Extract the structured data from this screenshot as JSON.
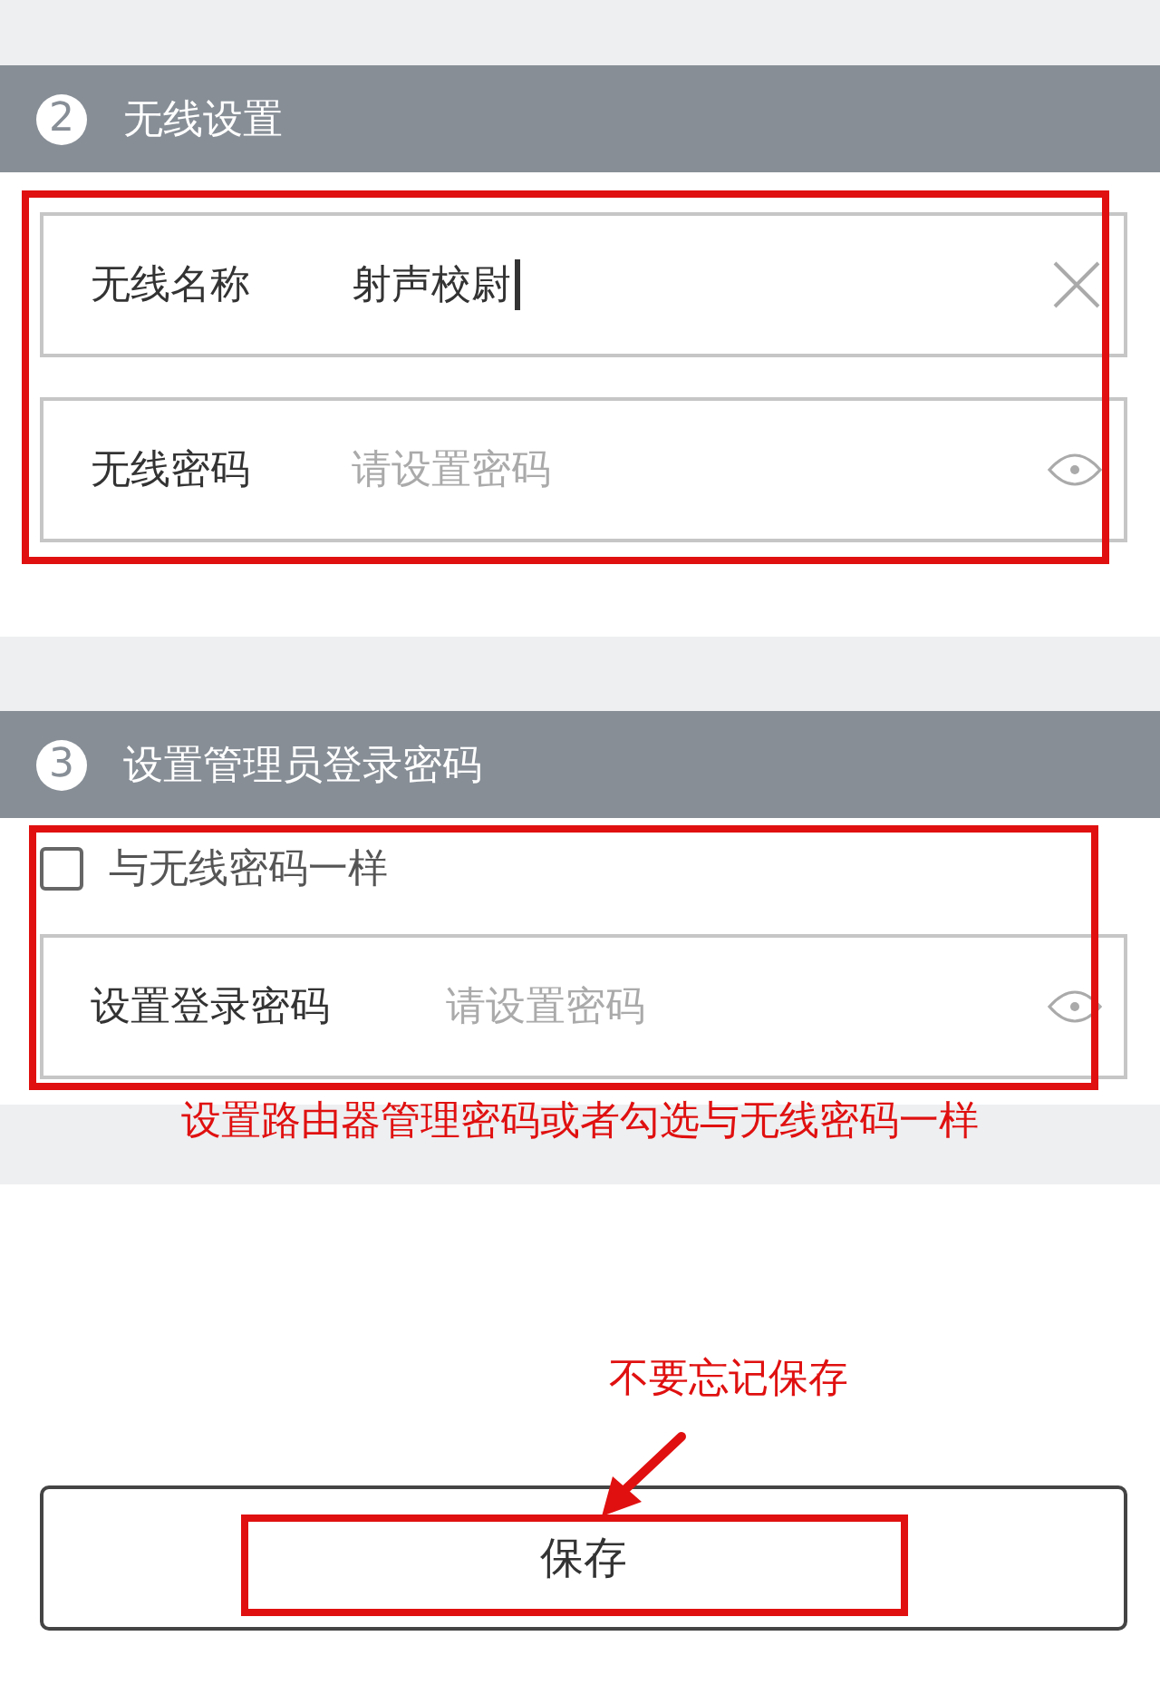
{
  "sections": [
    {
      "number": "2",
      "title": "无线设置",
      "fields": [
        {
          "kind": "text",
          "label": "无线名称",
          "value": "射声校尉"
        },
        {
          "kind": "password",
          "label": "无线密码",
          "placeholder": "请设置密码"
        }
      ]
    },
    {
      "number": "3",
      "title": "设置管理员登录密码",
      "checkbox": {
        "label": "与无线密码一样",
        "checked": false
      },
      "fields": [
        {
          "kind": "password",
          "label": "设置登录密码",
          "placeholder": "请设置密码"
        }
      ],
      "note": "设置路由器管理密码或者勾选与无线密码一样"
    }
  ],
  "save_note": "不要忘记保存",
  "save_button": "保存"
}
